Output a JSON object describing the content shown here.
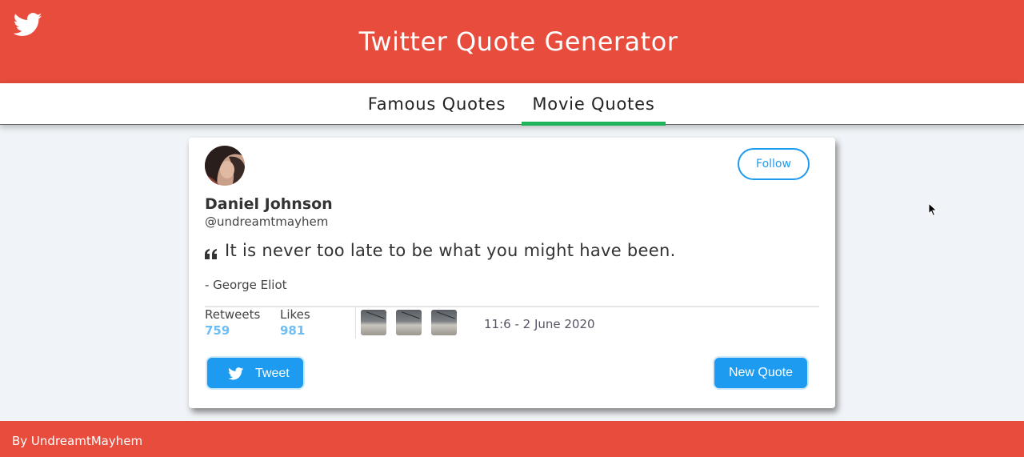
{
  "header": {
    "title": "Twitter Quote Generator",
    "logo_icon": "twitter-bird-icon",
    "background": "#e74c3c"
  },
  "nav": {
    "tabs": [
      {
        "label": "Famous Quotes",
        "active": false
      },
      {
        "label": "Movie Quotes",
        "active": true
      }
    ],
    "active_color": "#1fb35a"
  },
  "card": {
    "avatar_icon": "avatar",
    "follow_label": "Follow",
    "name": "Daniel Johnson",
    "handle": "@undreamtmayhem",
    "quote_icon": "quote-icon",
    "quote": "It is never too late to be what you might have been.",
    "author": "- George Eliot",
    "stats": {
      "retweets_label": "Retweets",
      "retweets_value": "759",
      "likes_label": "Likes",
      "likes_value": "981"
    },
    "timestamp": "11:6 - 2 June 2020",
    "tweet_label": "Tweet",
    "new_quote_label": "New Quote",
    "accent": "#1d9bf0"
  },
  "footer": {
    "credit": "By UndreamtMayhem"
  }
}
